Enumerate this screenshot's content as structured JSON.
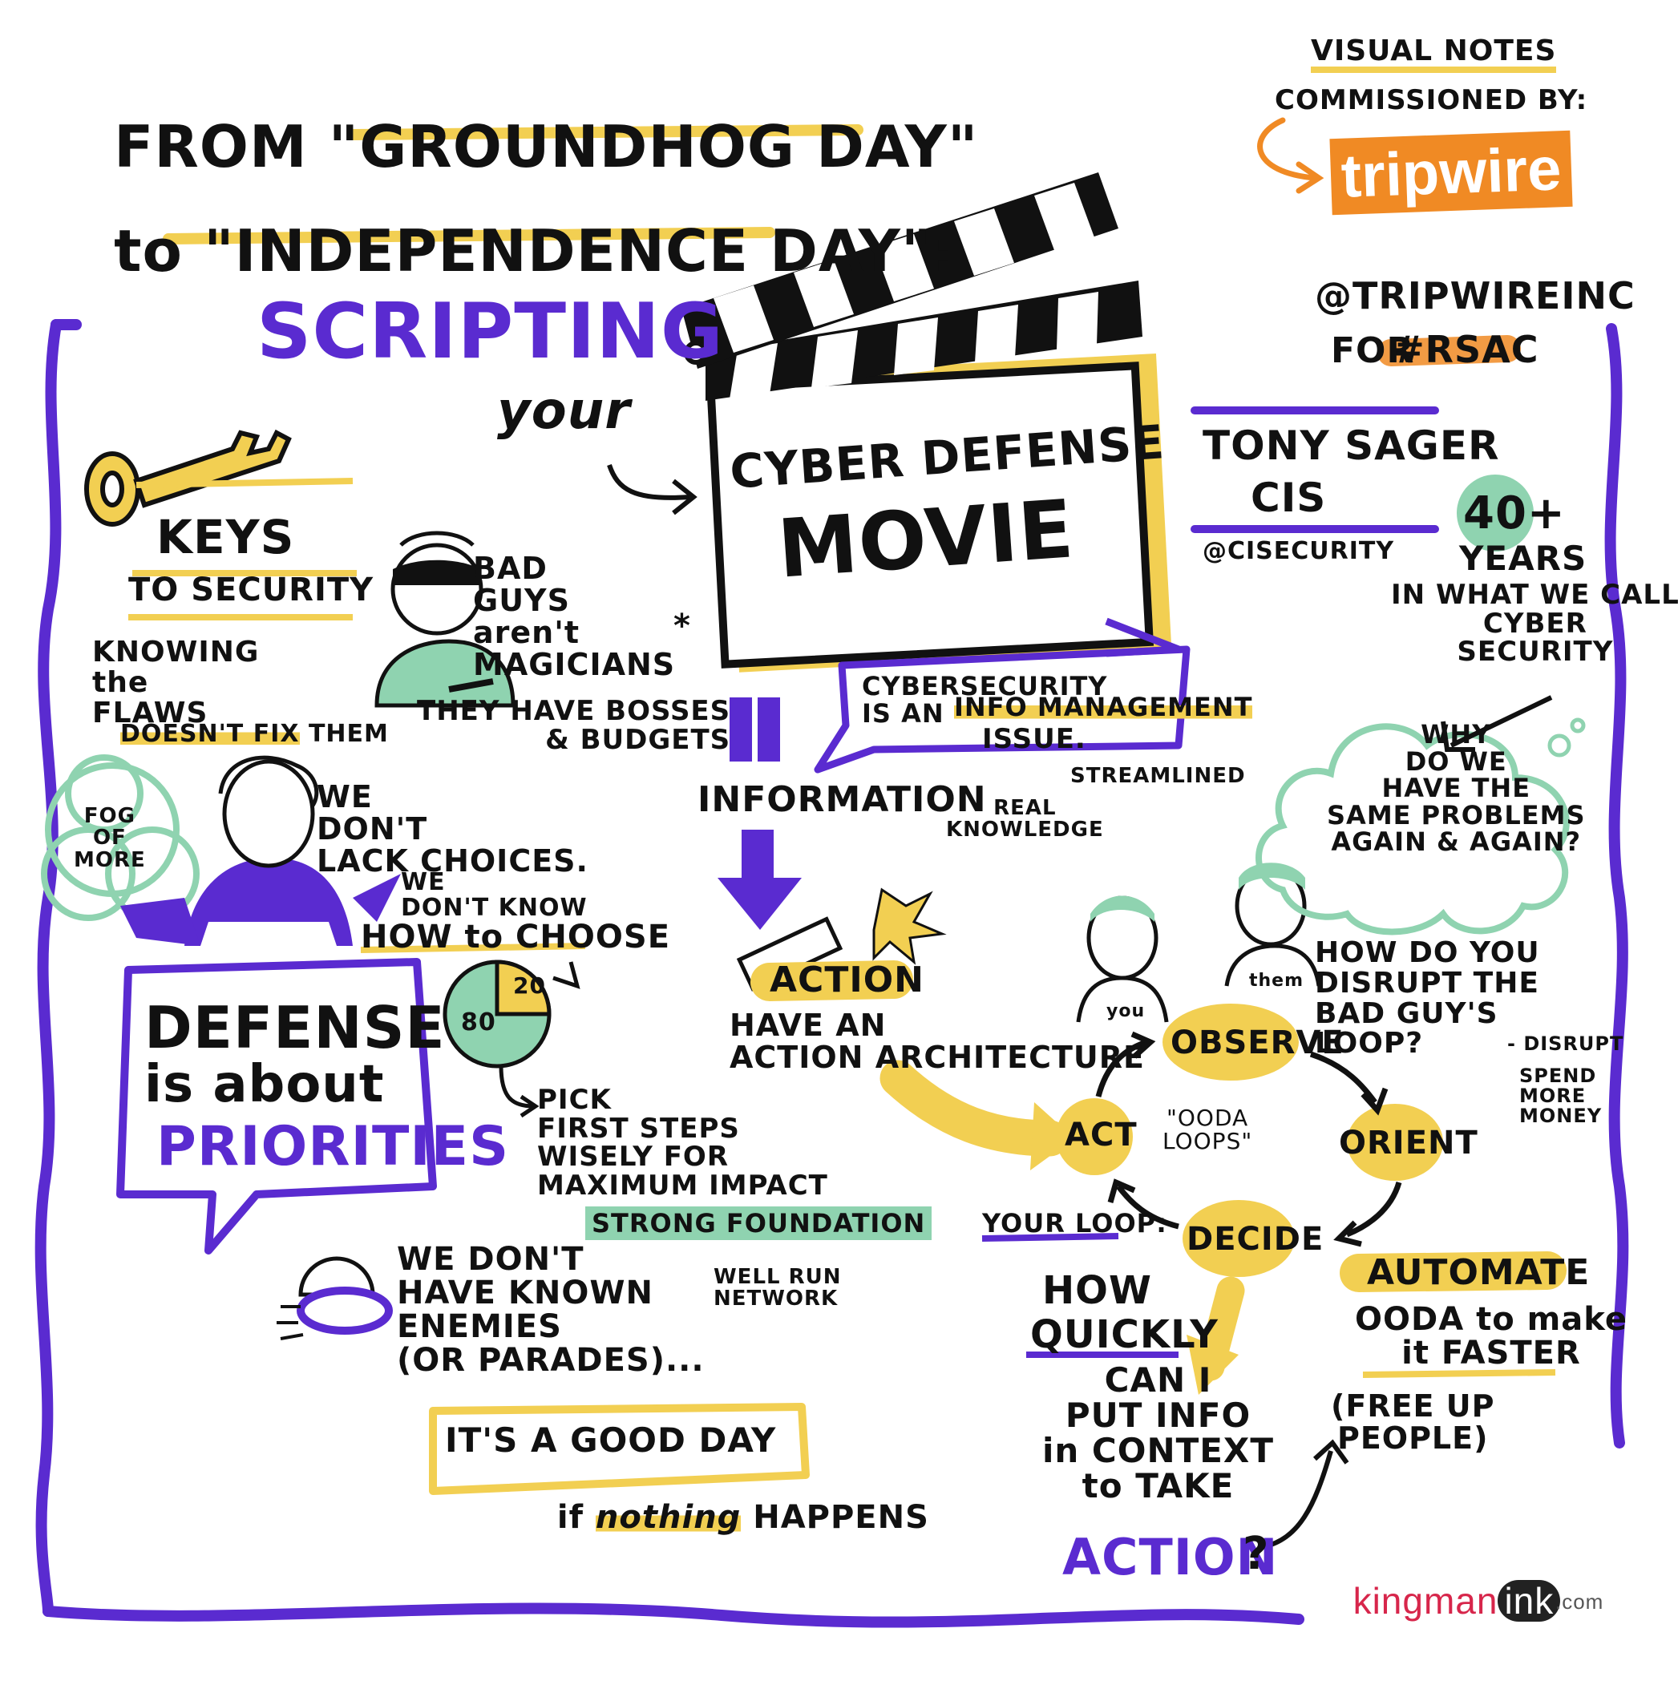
{
  "colors": {
    "purple": "#5a2bd0",
    "yellow": "#f2cf52",
    "green": "#8fd3b0",
    "orange": "#f08a24",
    "ink": "#111111",
    "pink": "#d7264b"
  },
  "title": {
    "line1_prefix": "FROM \"",
    "line1_movie": "GROUNDHOG DAY",
    "line1_suffix": "\"",
    "line2_prefix": "to \"",
    "line2_movie": "INDEPENDENCE DAY",
    "line2_suffix": "\":",
    "scripting": "SCRIPTING",
    "your": "your",
    "clapper_line1": "CYBER DEFENSE",
    "clapper_line2": "MOVIE"
  },
  "sponsor": {
    "visual_notes": "VISUAL NOTES",
    "commissioned_by": "COMMISSIONED BY:",
    "logo_text": "tripwire",
    "handle": "@TRIPWIREINC",
    "for": "FOR",
    "hashtag": "#RSAC"
  },
  "speaker": {
    "name": "TONY SAGER",
    "org": "CIS",
    "handle": "@CISECURITY"
  },
  "years": {
    "big": "40+",
    "years": "YEARS",
    "rest": "IN WHAT WE CALL\nCYBER\nSECURITY"
  },
  "cloud_question": "WHY\nDO WE\nHAVE THE\nSAME PROBLEMS\nAGAIN & AGAIN?",
  "keys": {
    "title": "KEYS",
    "subtitle": "TO SECURITY",
    "knowing": "KNOWING\nthe\nFLAWS",
    "doesnt_fix": "DOESN'T FIX",
    "them": "THEM"
  },
  "bad_guys": {
    "text": "BAD\nGUYS\naren't\nMAGICIANS",
    "asterisk": "*",
    "bosses": "THEY HAVE BOSSES\n& BUDGETS"
  },
  "fog": "FOG\nOF\nMORE",
  "choices": {
    "we_dont": "WE\nDON'T\nLACK CHOICES.",
    "we_dont_know": "WE\nDON'T KNOW",
    "how_to_choose": "HOW to CHOOSE"
  },
  "pie": {
    "big": "80",
    "small": "20"
  },
  "defense": {
    "line1": "DEFENSE",
    "line2": "is about",
    "line3": "PRIORITIES"
  },
  "pick": {
    "text": "PICK\nFIRST STEPS\nWISELY FOR\nMAXIMUM IMPACT",
    "foundation": "STRONG FOUNDATION",
    "network": "WELL RUN\nNETWORK"
  },
  "enemies": {
    "text": "WE DON'T\nHAVE KNOWN\nENEMIES\n(OR PARADES)...",
    "good_day": "IT'S A GOOD DAY",
    "if": "if",
    "nothing": "nothing",
    "happens": "HAPPENS"
  },
  "info": {
    "cyber": "CYBERSECURITY\nIS AN",
    "info_mgmt": "INFO MANAGEMENT",
    "issue": "ISSUE.",
    "information": "INFORMATION",
    "real": "REAL\nKNOWLEDGE",
    "streamlined": "STREAMLINED"
  },
  "action": {
    "label": "ACTION",
    "text": "HAVE AN\nACTION ARCHITECTURE"
  },
  "ooda": {
    "observe": "OBSERVE",
    "orient": "ORIENT",
    "decide": "DECIDE",
    "act": "ACT",
    "center": "\"OODA\nLOOPS\"",
    "you": "you",
    "them": "them"
  },
  "disrupt": {
    "question": "HOW DO YOU\nDISRUPT THE\nBAD GUY'S\nLOOP?",
    "a": "- DISRUPT",
    "b": "SPEND\nMORE\nMONEY"
  },
  "your_loop": {
    "label": "YOUR LOOP:",
    "how": "HOW",
    "quickly": "QUICKLY",
    "rest": "CAN I\nPUT INFO\nin CONTEXT\nto TAKE",
    "action": "ACTION",
    "q": "?"
  },
  "automate": {
    "title": "AUTOMATE",
    "text": "OODA to make\nit FASTER",
    "free": "(FREE UP\nPEOPLE)"
  },
  "credit": {
    "kingman": "kingman",
    "ink": "ink",
    "com": ".com"
  }
}
